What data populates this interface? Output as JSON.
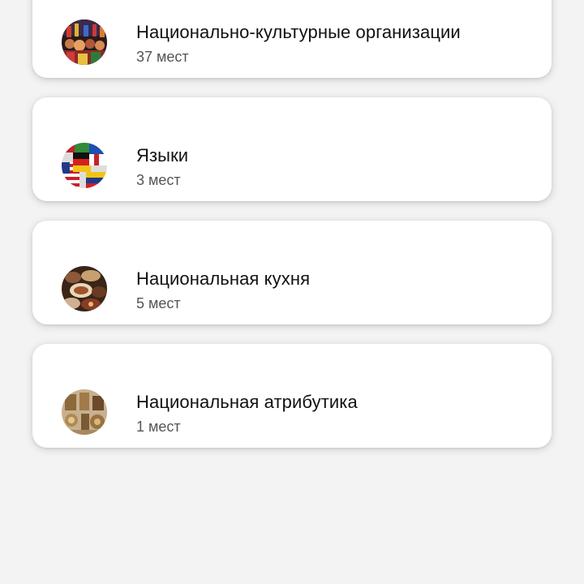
{
  "categories": [
    {
      "title": "Национально-культурные организации",
      "count": "37 мест",
      "icon": "culture-crowd-image"
    },
    {
      "title": "Языки",
      "count": "3 мест",
      "icon": "flags-image"
    },
    {
      "title": "Национальная кухня",
      "count": "5 мест",
      "icon": "food-image"
    },
    {
      "title": "Национальная атрибутика",
      "count": "1 мест",
      "icon": "attributes-image"
    }
  ]
}
